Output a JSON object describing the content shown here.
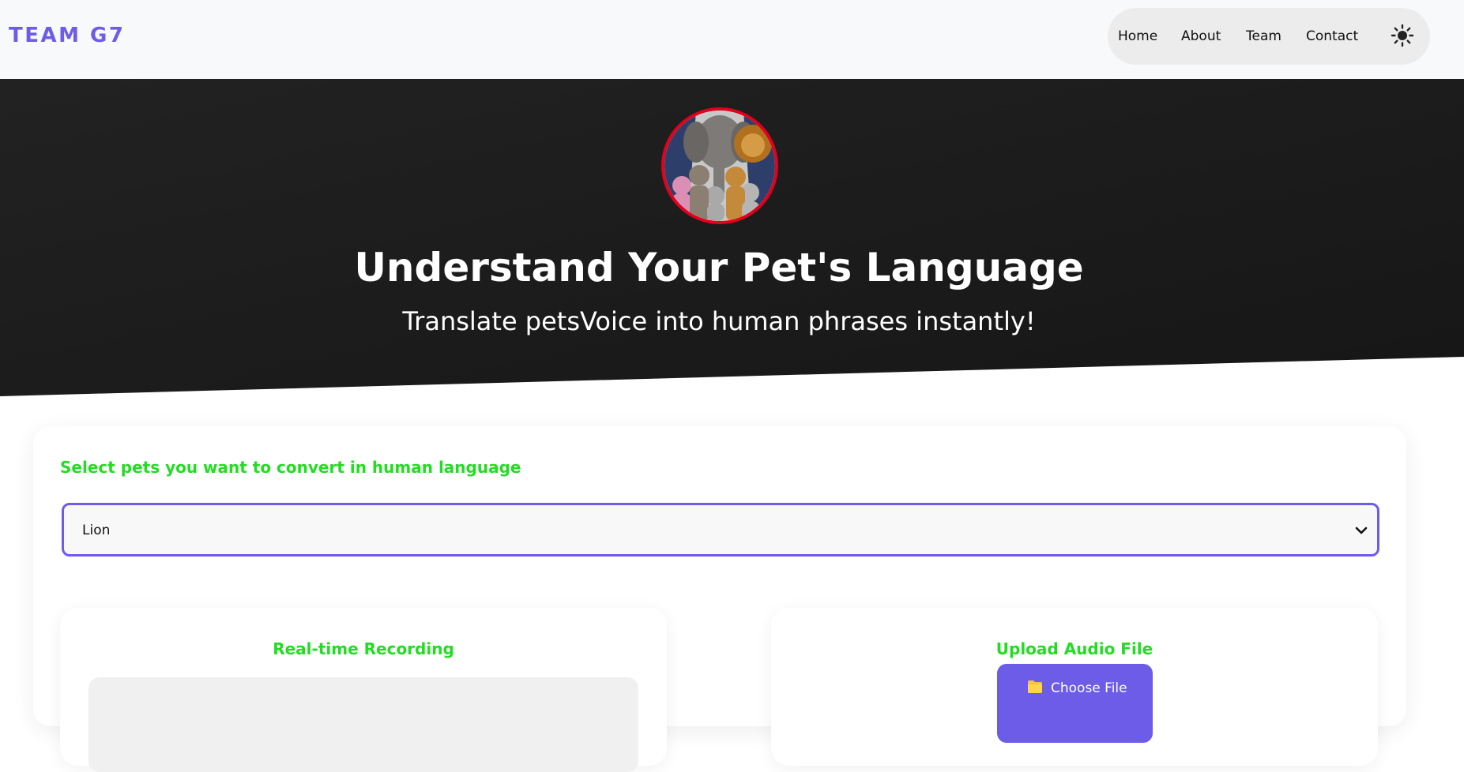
{
  "header": {
    "brand": "TEAM G7",
    "nav": [
      "Home",
      "About",
      "Team",
      "Contact"
    ],
    "theme_icon": "sun-icon"
  },
  "hero": {
    "image": "pets-group-avatar",
    "title": "Understand Your Pet's Language",
    "subtitle": "Translate petsVoice into human phrases instantly!"
  },
  "main": {
    "select_label": "Select pets you want to convert in human language",
    "select_value": "Lion",
    "recording_title": "Real-time Recording",
    "upload_title": "Upload Audio File",
    "choose_file_label": "Choose File",
    "folder_icon": "folder-icon"
  },
  "colors": {
    "accent": "#6c5ce7",
    "heading_green": "#22dd22",
    "hero_bg": "#1c1c1c",
    "avatar_border": "#e3001b"
  }
}
